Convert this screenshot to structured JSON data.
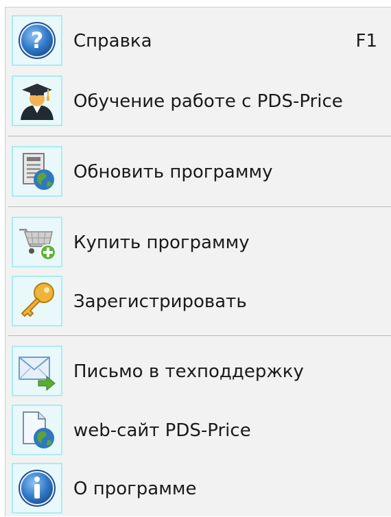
{
  "menu": {
    "items": [
      {
        "label": "Справка",
        "shortcut": "F1",
        "icon": "help-icon"
      },
      {
        "label": "Обучение работе с PDS-Price",
        "icon": "graduate-icon"
      },
      {
        "label": "Обновить программу",
        "icon": "update-globe-icon"
      },
      {
        "label": "Купить программу",
        "icon": "cart-add-icon"
      },
      {
        "label": "Зарегистрировать",
        "icon": "key-icon"
      },
      {
        "label": "Письмо в техподдержку",
        "icon": "mail-send-icon"
      },
      {
        "label": "web-сайт PDS-Price",
        "icon": "web-page-globe-icon"
      },
      {
        "label": "О программе",
        "icon": "info-icon"
      }
    ]
  },
  "colors": {
    "menu_background": "#f2f2f2",
    "icon_frame": "#a9ecf2",
    "separator": "#b8b8b8"
  }
}
